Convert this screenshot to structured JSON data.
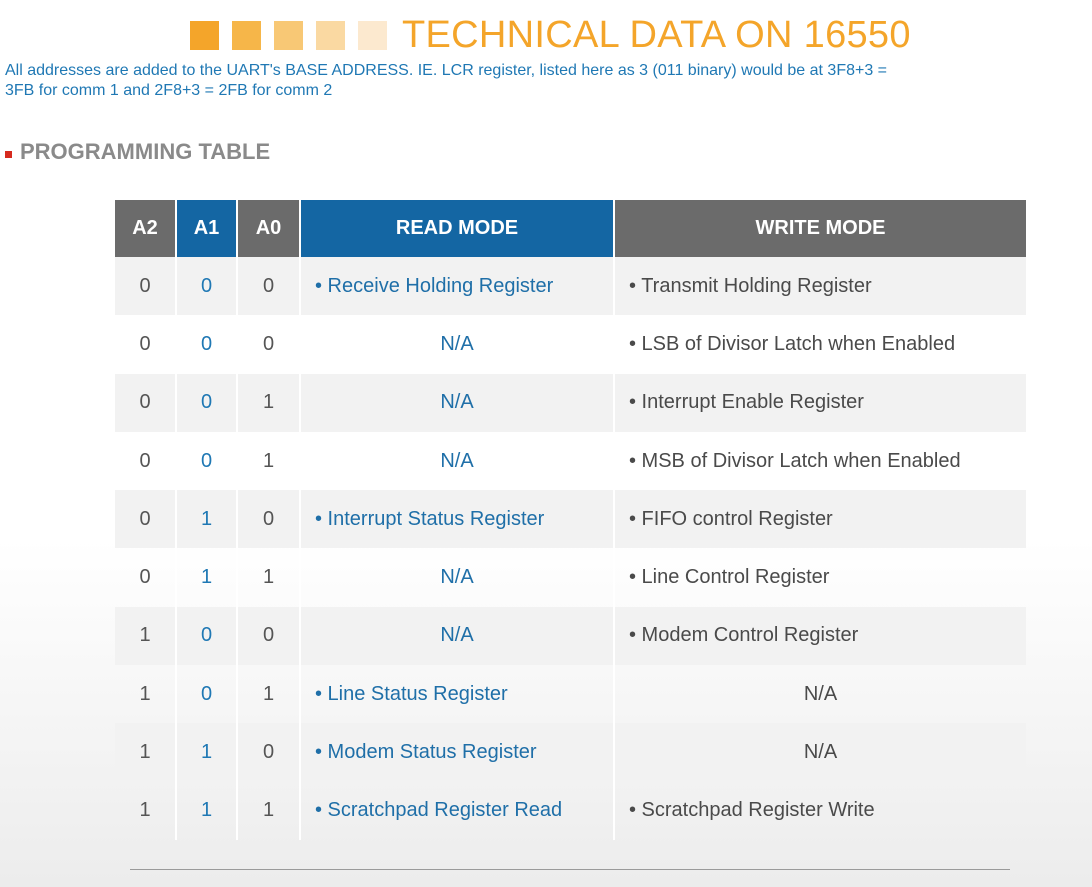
{
  "title": {
    "text": "TECHNICAL DATA ON 16550",
    "squares": [
      "#f4a52a",
      "#f6b649",
      "#f8c875",
      "#fad9a2",
      "#fce9cf"
    ]
  },
  "intro": {
    "line1": "All addresses are added to the UART's BASE ADDRESS. IE. LCR register, listed here as 3 (011 binary) would be at 3F8+3 =",
    "line2": "3FB for comm 1 and 2F8+3 = 2FB for comm 2"
  },
  "section": {
    "heading": "PROGRAMMING TABLE"
  },
  "table": {
    "headers": [
      "A2",
      "A1",
      "A0",
      "READ MODE",
      "WRITE MODE"
    ],
    "rows": [
      {
        "a2": "0",
        "a1": "0",
        "a0": "0",
        "read": "• Receive Holding Register",
        "write": "• Transmit Holding Register"
      },
      {
        "a2": "0",
        "a1": "0",
        "a0": "0",
        "read": "N/A",
        "write": "• LSB of Divisor Latch when Enabled"
      },
      {
        "a2": "0",
        "a1": "0",
        "a0": "1",
        "read": "N/A",
        "write": "• Interrupt Enable Register"
      },
      {
        "a2": "0",
        "a1": "0",
        "a0": "1",
        "read": "N/A",
        "write": "• MSB of Divisor Latch when Enabled"
      },
      {
        "a2": "0",
        "a1": "1",
        "a0": "0",
        "read": "• Interrupt Status Register",
        "write": "• FIFO control Register"
      },
      {
        "a2": "0",
        "a1": "1",
        "a0": "1",
        "read": "N/A",
        "write": "• Line Control Register"
      },
      {
        "a2": "1",
        "a1": "0",
        "a0": "0",
        "read": "N/A",
        "write": "• Modem Control Register"
      },
      {
        "a2": "1",
        "a1": "0",
        "a0": "1",
        "read": "• Line Status Register",
        "write": "N/A"
      },
      {
        "a2": "1",
        "a1": "1",
        "a0": "0",
        "read": "• Modem Status Register",
        "write": "N/A"
      },
      {
        "a2": "1",
        "a1": "1",
        "a0": "1",
        "read": "• Scratchpad Register Read",
        "write": "• Scratchpad Register Write"
      }
    ]
  },
  "colors": {
    "accent_orange": "#f4a52a",
    "link_blue": "#1f78b4",
    "header_gray": "#6b6b6b",
    "header_blue": "#1466a3",
    "marker_red": "#d62a1e"
  }
}
